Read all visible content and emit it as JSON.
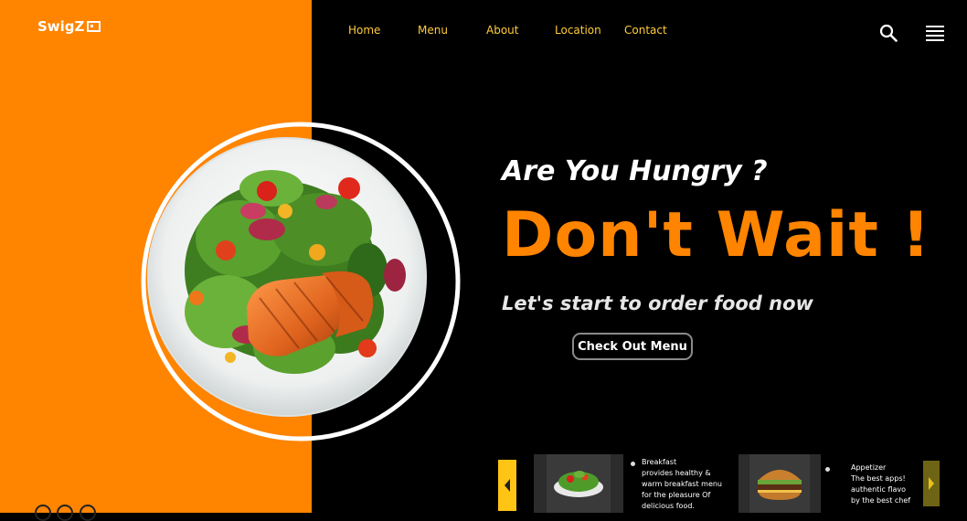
{
  "brand": {
    "name": "SwigZ"
  },
  "nav": {
    "items": [
      {
        "label": "Home",
        "active": true
      },
      {
        "label": "Menu"
      },
      {
        "label": "About"
      },
      {
        "label": "Location"
      },
      {
        "label": "Contact"
      }
    ]
  },
  "icons": {
    "search": "search-icon",
    "menu": "hamburger-menu-icon",
    "prev": "chevron-left-icon",
    "next": "chevron-right-icon"
  },
  "hero": {
    "question": "Are You Hungry ?",
    "headline": "Don't Wait !",
    "subline": "Let's start to order food now",
    "cta_label": "Check Out Menu"
  },
  "cards": [
    {
      "title": "Breakfast",
      "lines": [
        "provides healthy &",
        "warm breakfast menu",
        "for the pleasure Of",
        "delicious food."
      ]
    },
    {
      "title": "Appetizer",
      "lines": [
        "The best apps!",
        "authentic flavo",
        "by the best chef"
      ]
    }
  ],
  "colors": {
    "accent": "#ff8400",
    "nav_text": "#ffcc3a",
    "background": "#000000",
    "arrow": "#ffc414"
  }
}
